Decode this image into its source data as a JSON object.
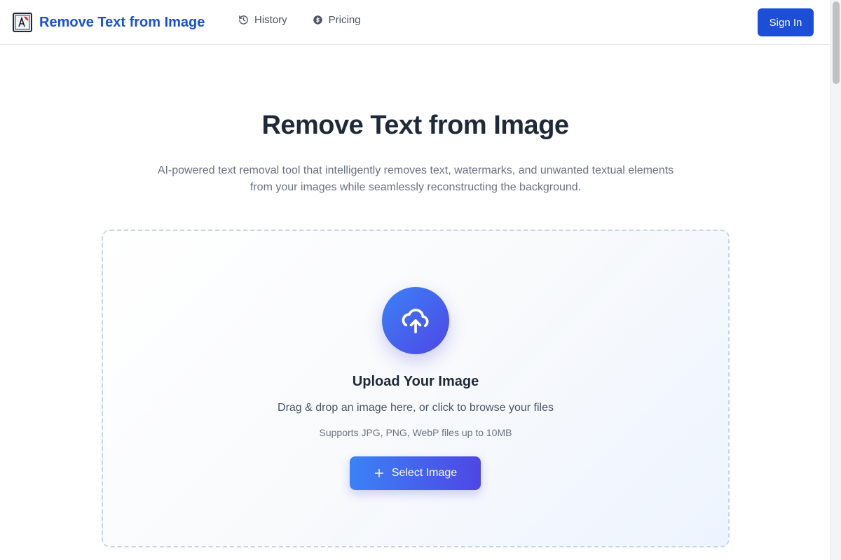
{
  "header": {
    "brand_name": "Remove Text from Image",
    "logo_icon": "image-text-logo-icon",
    "nav": [
      {
        "label": "History",
        "icon": "history-icon"
      },
      {
        "label": "Pricing",
        "icon": "coin-icon"
      }
    ],
    "sign_in_label": "Sign In"
  },
  "hero": {
    "title": "Remove Text from Image",
    "subtitle": "AI-powered text removal tool that intelligently removes text, watermarks, and unwanted textual elements from your images while seamlessly reconstructing the background."
  },
  "upload": {
    "icon": "cloud-upload-icon",
    "title": "Upload Your Image",
    "description": "Drag & drop an image here, or click to browse your files",
    "note": "Supports JPG, PNG, WebP files up to 10MB",
    "button_label": "Select Image",
    "button_icon": "plus-icon"
  },
  "colors": {
    "brand": "#1d4ed8",
    "gradient_start": "#3b82f6",
    "gradient_end": "#4f46e5"
  }
}
